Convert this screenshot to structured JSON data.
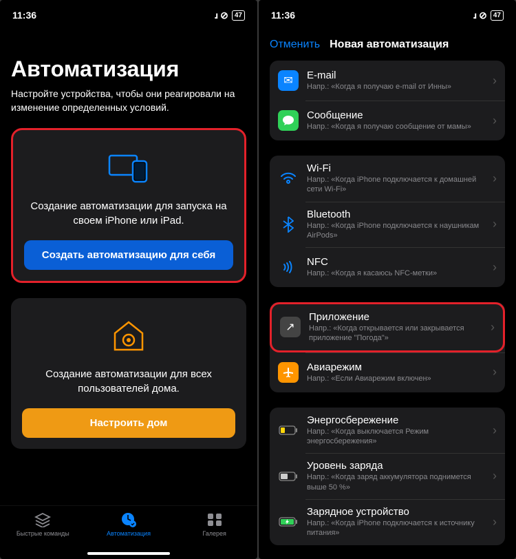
{
  "status": {
    "time": "11:36",
    "battery": "47"
  },
  "left": {
    "title": "Автоматизация",
    "subtitle": "Настройте устройства, чтобы они реагировали на изменение определенных условий.",
    "card1": {
      "text": "Создание автоматизации для запуска на своем iPhone или iPad.",
      "button": "Создать автоматизацию для себя"
    },
    "card2": {
      "text": "Создание автоматизации для всех пользователей дома.",
      "button": "Настроить дом"
    },
    "tabs": {
      "shortcuts": "Быстрые команды",
      "automation": "Автоматизация",
      "gallery": "Галерея"
    }
  },
  "right": {
    "cancel": "Отменить",
    "title": "Новая автоматизация",
    "items": {
      "email": {
        "title": "E-mail",
        "sub": "Напр.: «Когда я получаю e-mail от Инны»"
      },
      "message": {
        "title": "Сообщение",
        "sub": "Напр.: «Когда я получаю сообщение от мамы»"
      },
      "wifi": {
        "title": "Wi-Fi",
        "sub": "Напр.: «Когда iPhone подключается к домашней сети Wi-Fi»"
      },
      "bluetooth": {
        "title": "Bluetooth",
        "sub": "Напр.: «Когда iPhone подключается к наушникам AirPods»"
      },
      "nfc": {
        "title": "NFC",
        "sub": "Напр.: «Когда я касаюсь NFC-метки»"
      },
      "app": {
        "title": "Приложение",
        "sub": "Напр.: «Когда открывается или закрывается приложение \"Погода\"»"
      },
      "airplane": {
        "title": "Авиарежим",
        "sub": "Напр.: «Если Авиарежим включен»"
      },
      "power": {
        "title": "Энергосбережение",
        "sub": "Напр.: «Когда выключается Режим энергосбережения»"
      },
      "batt": {
        "title": "Уровень заряда",
        "sub": "Напр.: «Когда заряд аккумулятора поднимется выше 50 %»"
      },
      "charge": {
        "title": "Зарядное устройство",
        "sub": "Напр.: «Когда iPhone подключается к источнику питания»"
      }
    }
  }
}
